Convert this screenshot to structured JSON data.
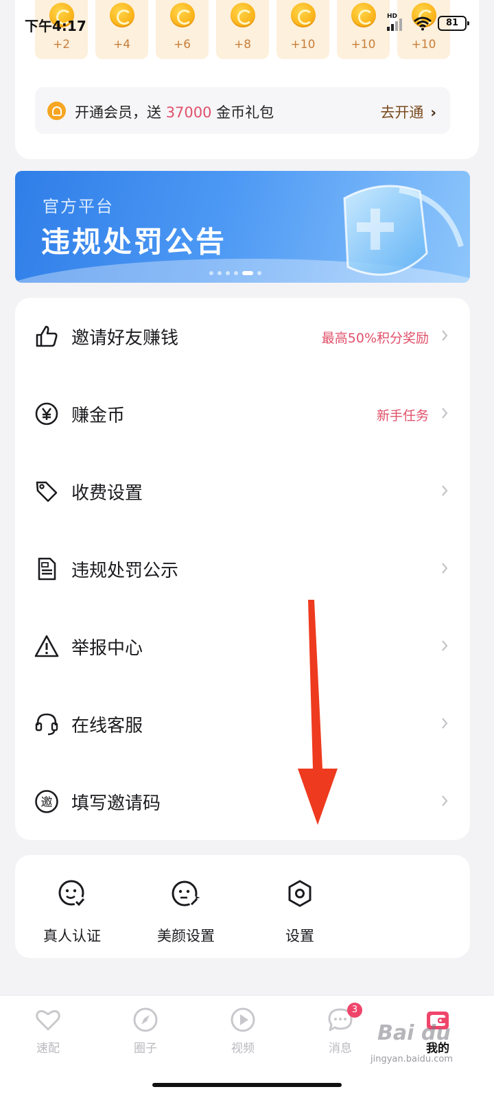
{
  "status_bar": {
    "time": "下午4:17",
    "network_label": "HD",
    "battery": "81"
  },
  "coins": {
    "rewards": [
      "+2",
      "+4",
      "+6",
      "+8",
      "+10",
      "+10",
      "+10"
    ]
  },
  "vip_banner": {
    "text_before": "开通会员，送 ",
    "highlight": "37000",
    "text_after": " 金币礼包",
    "action": "去开通",
    "action_chevron": "›",
    "highlight_color": "#e0506a"
  },
  "promo_banner": {
    "subtitle": "官方平台",
    "title": "违规处罚公告",
    "slide_count": 6,
    "active_slide": 5
  },
  "menu": {
    "items": [
      {
        "label": "邀请好友赚钱",
        "hint": "最高50%积分奖励",
        "icon": "thumbs-up-icon"
      },
      {
        "label": "赚金币",
        "hint": "新手任务",
        "icon": "yen-coin-icon"
      },
      {
        "label": "收费设置",
        "hint": "",
        "icon": "price-tag-icon"
      },
      {
        "label": "违规处罚公示",
        "hint": "",
        "icon": "penalty-document-icon"
      },
      {
        "label": "举报中心",
        "hint": "",
        "icon": "warning-icon"
      },
      {
        "label": "在线客服",
        "hint": "",
        "icon": "headset-icon"
      },
      {
        "label": "填写邀请码",
        "hint": "",
        "icon": "invite-code-icon",
        "icon_glyph": "邀"
      }
    ],
    "hint_color": "#e0506a"
  },
  "tools": {
    "items": [
      {
        "label": "真人认证",
        "icon": "face-verify-icon"
      },
      {
        "label": "美颜设置",
        "icon": "beauty-face-icon"
      },
      {
        "label": "设置",
        "icon": "settings-hexagon-icon"
      }
    ]
  },
  "bottom_nav": {
    "items": [
      {
        "label": "速配",
        "icon": "heart-icon",
        "active": false
      },
      {
        "label": "圈子",
        "icon": "compass-icon",
        "active": false
      },
      {
        "label": "视频",
        "icon": "play-icon",
        "active": false
      },
      {
        "label": "消息",
        "icon": "chat-icon",
        "active": false,
        "badge": "3"
      },
      {
        "label": "我的",
        "icon": "wallet-icon",
        "active": true
      }
    ],
    "active_color": "#f0456b"
  },
  "watermark": {
    "main": "Bai du",
    "sub": "jingyan.baidu.com"
  }
}
